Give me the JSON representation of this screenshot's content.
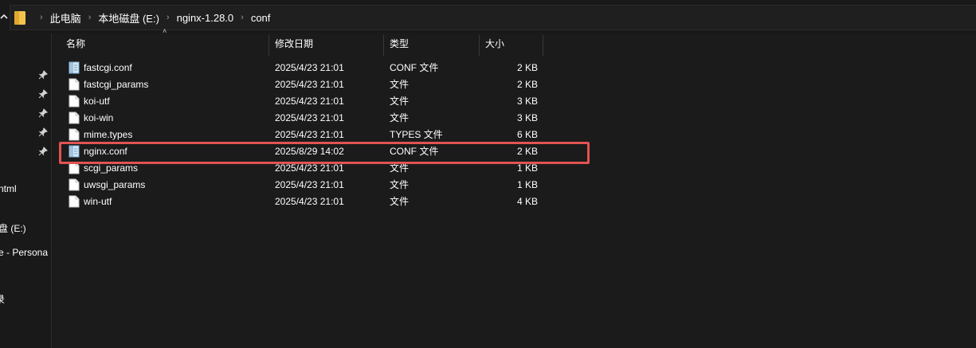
{
  "address_bar": {
    "crumbs": [
      "此电脑",
      "本地磁盘 (E:)",
      "nginx-1.28.0",
      "conf"
    ]
  },
  "nav_pane": {
    "items": [
      "ntml",
      "盘 (E:)",
      "e - Persona",
      "录"
    ]
  },
  "columns": {
    "name": "名称",
    "date": "修改日期",
    "type": "类型",
    "size": "大小"
  },
  "files": [
    {
      "name": "fastcgi.conf",
      "date": "2025/4/23 21:01",
      "type": "CONF 文件",
      "size": "2 KB",
      "icon": "conf-file-icon"
    },
    {
      "name": "fastcgi_params",
      "date": "2025/4/23 21:01",
      "type": "文件",
      "size": "2 KB",
      "icon": "blank-file-icon"
    },
    {
      "name": "koi-utf",
      "date": "2025/4/23 21:01",
      "type": "文件",
      "size": "3 KB",
      "icon": "blank-file-icon"
    },
    {
      "name": "koi-win",
      "date": "2025/4/23 21:01",
      "type": "文件",
      "size": "3 KB",
      "icon": "blank-file-icon"
    },
    {
      "name": "mime.types",
      "date": "2025/4/23 21:01",
      "type": "TYPES 文件",
      "size": "6 KB",
      "icon": "blank-file-icon"
    },
    {
      "name": "nginx.conf",
      "date": "2025/8/29 14:02",
      "type": "CONF 文件",
      "size": "2 KB",
      "icon": "conf-file-icon"
    },
    {
      "name": "scgi_params",
      "date": "2025/4/23 21:01",
      "type": "文件",
      "size": "1 KB",
      "icon": "blank-file-icon"
    },
    {
      "name": "uwsgi_params",
      "date": "2025/4/23 21:01",
      "type": "文件",
      "size": "1 KB",
      "icon": "blank-file-icon"
    },
    {
      "name": "win-utf",
      "date": "2025/4/23 21:01",
      "type": "文件",
      "size": "4 KB",
      "icon": "blank-file-icon"
    }
  ],
  "highlight_color": "#e25353"
}
